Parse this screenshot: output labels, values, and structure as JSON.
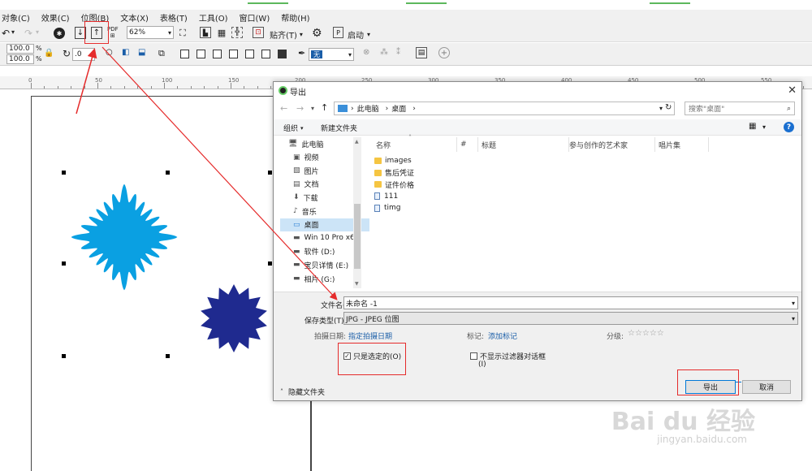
{
  "menu": [
    "对象(C)",
    "效果(C)",
    "位图(B)",
    "文本(X)",
    "表格(T)",
    "工具(O)",
    "窗口(W)",
    "帮助(H)"
  ],
  "toolbar1": {
    "pdf_label": "PDF",
    "zoom_value": "62%",
    "paste_label": "贴齐(T)",
    "launch_label": "启动"
  },
  "toolbar2": {
    "width_value": "100.0",
    "height_value": "100.0",
    "percent": "%",
    "angle_value": ".0",
    "outline_value": "无"
  },
  "ruler_labels": [
    "0",
    "50",
    "100",
    "150",
    "200",
    "250",
    "300",
    "350",
    "400",
    "450",
    "500",
    "550"
  ],
  "dialog": {
    "title": "导出",
    "address_path": [
      "此电脑",
      "桌面"
    ],
    "search_placeholder": "搜索\"桌面\"",
    "organize_label": "组织",
    "new_folder_label": "新建文件夹",
    "nav_items": [
      {
        "label": "此电脑",
        "icon": "computer-icon"
      },
      {
        "label": "视频",
        "icon": "video-icon"
      },
      {
        "label": "图片",
        "icon": "picture-icon"
      },
      {
        "label": "文档",
        "icon": "document-icon"
      },
      {
        "label": "下载",
        "icon": "download-icon"
      },
      {
        "label": "音乐",
        "icon": "music-icon"
      },
      {
        "label": "桌面",
        "icon": "desktop-icon",
        "selected": true
      },
      {
        "label": "Win 10 Pro x64",
        "icon": "drive-icon"
      },
      {
        "label": "软件 (D:)",
        "icon": "drive-icon"
      },
      {
        "label": "宝贝详情 (E:)",
        "icon": "drive-icon"
      },
      {
        "label": "相片 (G:)",
        "icon": "drive-icon"
      }
    ],
    "columns": [
      "名称",
      "#",
      "标题",
      "参与创作的艺术家",
      "唱片集"
    ],
    "files": [
      {
        "name": "images",
        "type": "folder"
      },
      {
        "name": "售后凭证",
        "type": "folder"
      },
      {
        "name": "证件价格",
        "type": "folder"
      },
      {
        "name": "111",
        "type": "image"
      },
      {
        "name": "timg",
        "type": "image"
      }
    ],
    "filename_label": "文件名(N):",
    "filename_value": "未命名 -1",
    "filetype_label": "保存类型(T):",
    "filetype_value": "JPG - JPEG 位图",
    "date_label": "拍摄日期:",
    "date_link": "指定拍摄日期",
    "tags_label": "标记:",
    "tags_link": "添加标记",
    "rating_label": "分级:",
    "rating_stars": "☆☆☆☆☆",
    "only_selected_label": "只是选定的(O)",
    "only_selected_checked": true,
    "hide_filter_label_1": "不显示过滤器对话框",
    "hide_filter_label_2": "(I)",
    "hide_folders_label": "隐藏文件夹",
    "export_button": "导出",
    "cancel_button": "取消"
  },
  "watermark": {
    "line1": "Bai du 经验",
    "line2": "jingyan.baidu.com"
  },
  "colors": {
    "shape_light_blue": "#0aa0e2",
    "shape_dark_blue": "#1f2a8f",
    "annotation_red": "#e52b2b",
    "selection_blue": "#cce4f7"
  }
}
